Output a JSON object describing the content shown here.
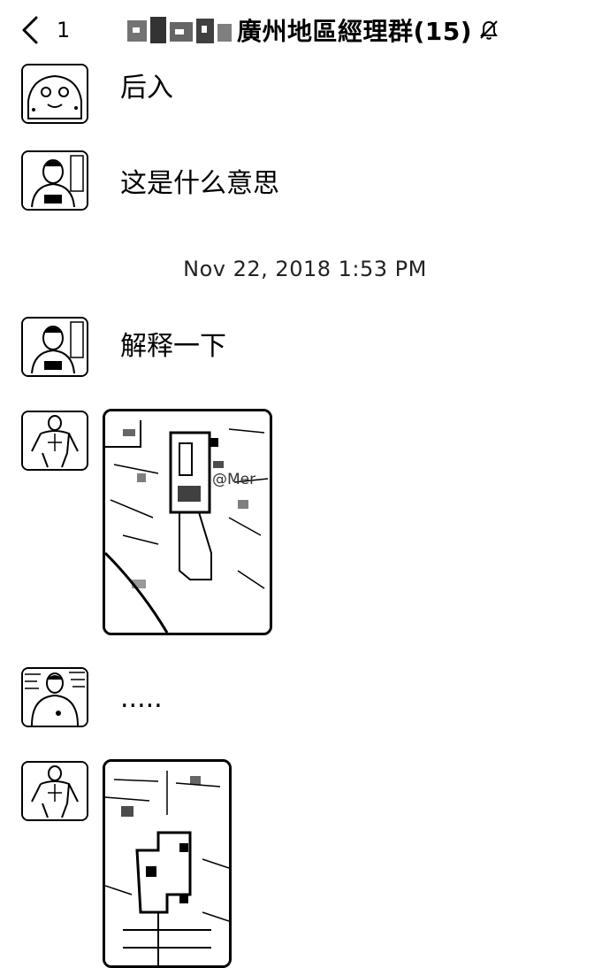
{
  "header": {
    "unread_count": "1",
    "title": "廣州地區經理群(15)",
    "back_icon": "chevron-left-icon",
    "mute_icon": "bell-slash-icon"
  },
  "messages": [
    {
      "type": "text",
      "text": "后入"
    },
    {
      "type": "text",
      "text": "这是什么意思"
    },
    {
      "type": "timestamp",
      "text": "Nov 22, 2018 1:53 PM"
    },
    {
      "type": "text",
      "text": "解释一下"
    },
    {
      "type": "image",
      "content": "map-screenshot"
    },
    {
      "type": "text",
      "text": "....."
    },
    {
      "type": "image",
      "content": "map-screenshot"
    }
  ],
  "watermark": "@Mer"
}
